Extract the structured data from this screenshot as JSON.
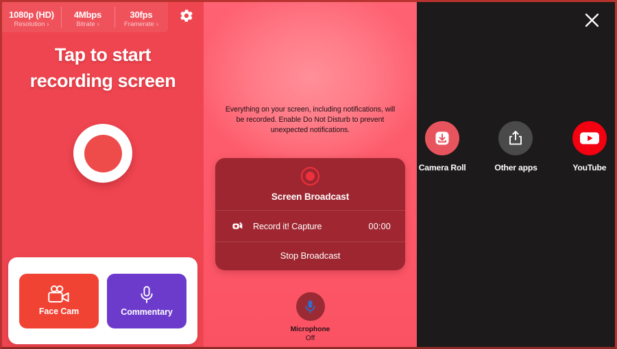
{
  "recorder_screen": {
    "settings": [
      {
        "value": "1080p (HD)",
        "label": "Resolution",
        "chevron": "›",
        "name": "resolution"
      },
      {
        "value": "4Mbps",
        "label": "Bitrate",
        "chevron": "›",
        "name": "bitrate"
      },
      {
        "value": "30fps",
        "label": "Framerate",
        "chevron": "›",
        "name": "framerate"
      }
    ],
    "gear_icon": "gear-icon",
    "title_line1": "Tap to start",
    "title_line2": "recording screen",
    "record_button": "record-button",
    "actions": [
      {
        "label": "Face Cam",
        "icon": "video-camera-icon",
        "color": "#f14334"
      },
      {
        "label": "Commentary",
        "icon": "microphone-icon",
        "color": "#6c3bcc"
      }
    ]
  },
  "broadcast_screen": {
    "notice": "Everything on your screen, including notifications, will be recorded. Enable Do Not Disturb to prevent unexpected notifications.",
    "sheet": {
      "record_icon": "record-dot-icon",
      "title": "Screen Broadcast",
      "app_icon": "record-it-app-icon",
      "app_name": "Record it! Capture",
      "timer": "00:00",
      "stop_label": "Stop Broadcast"
    },
    "microphone": {
      "icon": "microphone-icon",
      "label": "Microphone",
      "state": "Off"
    }
  },
  "share_screen": {
    "close_icon": "close-icon",
    "targets": [
      {
        "label": "Camera Roll",
        "icon": "save-to-camera-roll-icon",
        "color": "#e8545e"
      },
      {
        "label": "Other apps",
        "icon": "share-icon",
        "color": "#4a4a4a"
      },
      {
        "label": "YouTube",
        "icon": "youtube-icon",
        "color": "#f30011"
      }
    ]
  }
}
